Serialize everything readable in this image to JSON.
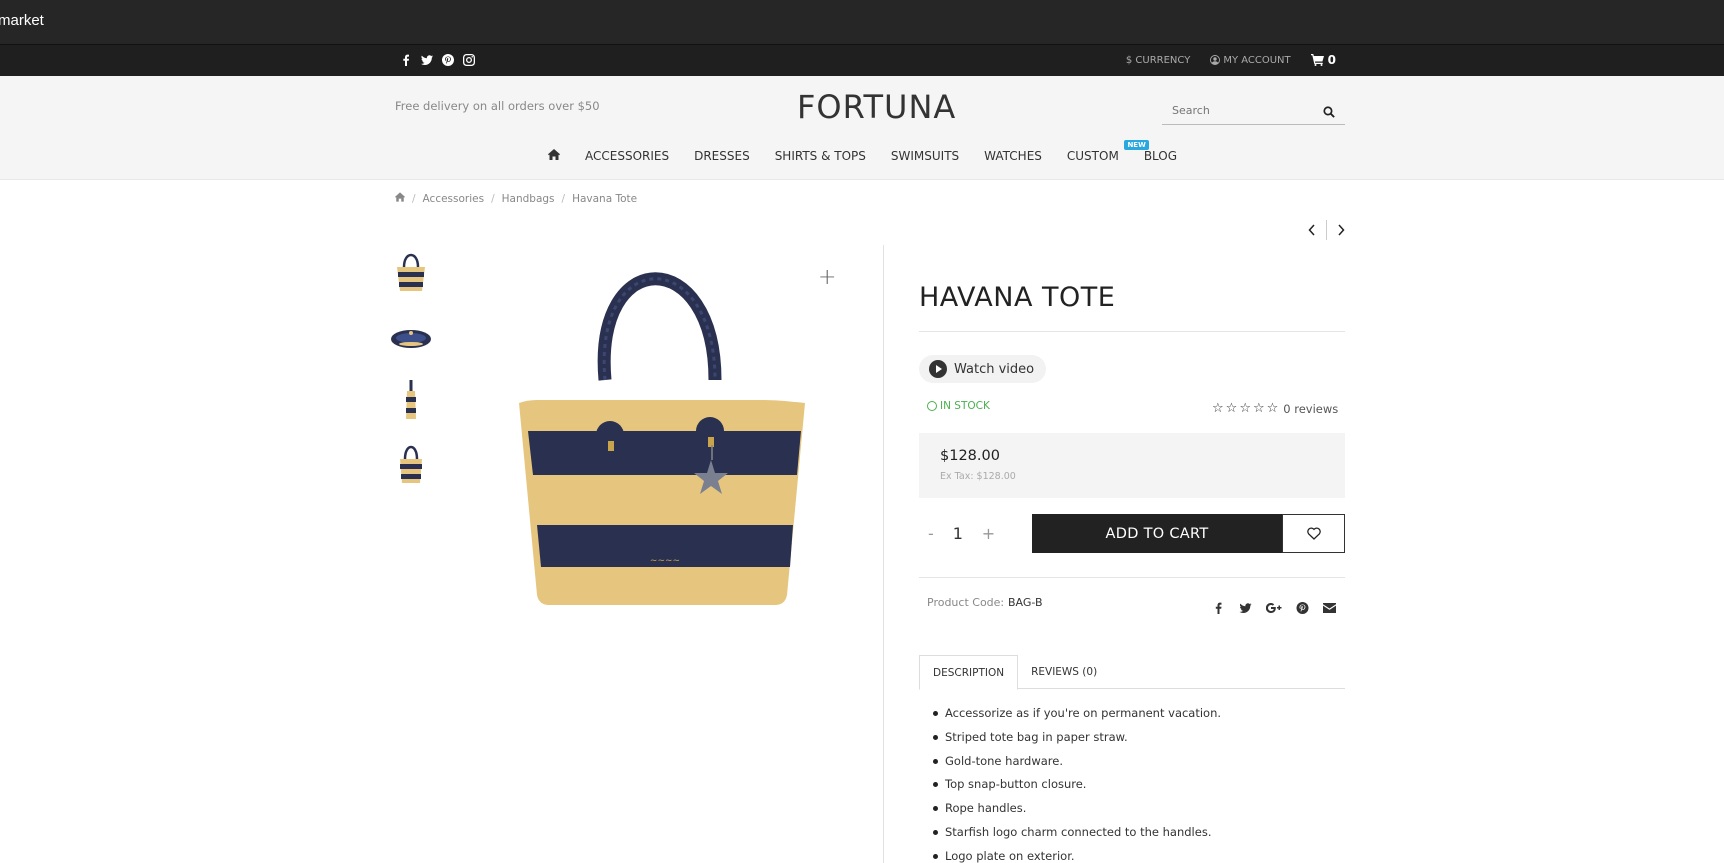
{
  "market": {
    "logo_text": "market"
  },
  "util": {
    "social_icons": [
      "facebook-icon",
      "twitter-icon",
      "pinterest-icon",
      "instagram-icon"
    ],
    "currency": "$ CURRENCY",
    "account": "MY ACCOUNT",
    "cart_count": "0"
  },
  "header": {
    "free_delivery": "Free delivery on all orders over $50",
    "brand": "FORTUNA",
    "search_placeholder": "Search"
  },
  "nav": {
    "items": [
      "ACCESSORIES",
      "DRESSES",
      "SHIRTS & TOPS",
      "SWIMSUITS",
      "WATCHES",
      "CUSTOM",
      "BLOG"
    ],
    "custom_badge": "NEW"
  },
  "breadcrumb": [
    "Accessories",
    "Handbags",
    "Havana Tote"
  ],
  "product": {
    "title": "HAVANA TOTE",
    "watch_video": "Watch video",
    "stock": "IN STOCK",
    "rating_stars": 0,
    "reviews_count": "0 reviews",
    "price": "$128.00",
    "ex_tax": "Ex Tax: $128.00",
    "quantity": "1",
    "qty_minus": "-",
    "qty_plus": "+",
    "add_to_cart": "ADD TO CART",
    "code_label": "Product Code:",
    "code_value": "BAG-B",
    "share_icons": [
      "facebook-icon",
      "twitter-icon",
      "google-plus-icon",
      "pinterest-icon",
      "email-icon"
    ]
  },
  "tabs": [
    "DESCRIPTION",
    "REVIEWS (0)"
  ],
  "description": [
    "Accessorize as if you're on permanent vacation.",
    "Striped tote bag in paper straw.",
    "Gold-tone hardware.",
    "Top snap-button closure.",
    "Rope handles.",
    "Starfish logo charm connected to the handles.",
    "Logo plate on exterior."
  ],
  "colors": {
    "bag_straw": "#e6c67e",
    "bag_navy": "#2a3150",
    "dark_bar": "#262626",
    "badge_blue": "#29a8e0",
    "stock_green": "#4caf50"
  }
}
